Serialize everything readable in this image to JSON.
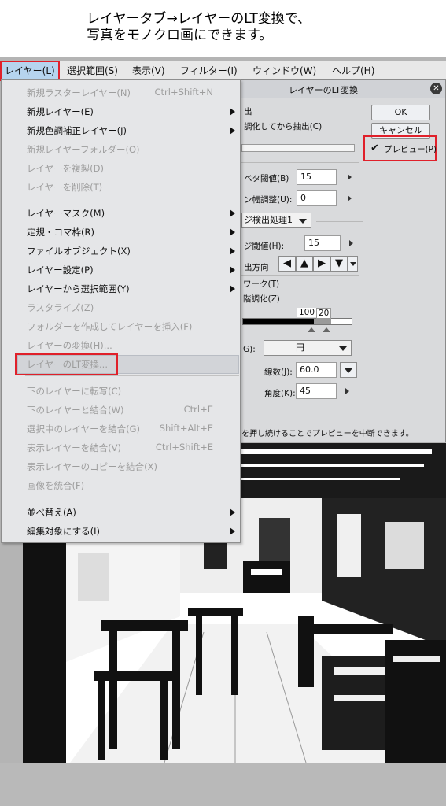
{
  "caption": {
    "line1": "レイヤータブ→レイヤーのLT変換で、",
    "line2": "写真をモノクロ画にできます。"
  },
  "menubar": {
    "items": [
      "レイヤー(L)",
      "選択範囲(S)",
      "表示(V)",
      "フィルター(I)",
      "ウィンドウ(W)",
      "ヘルプ(H)"
    ]
  },
  "layer_menu": {
    "items": [
      {
        "label": "新規ラスターレイヤー(N)",
        "shortcut": "Ctrl+Shift+N",
        "enabled": false
      },
      {
        "label": "新規レイヤー(E)",
        "shortcut": "",
        "enabled": true,
        "submenu": true
      },
      {
        "label": "新規色調補正レイヤー(J)",
        "shortcut": "",
        "enabled": true,
        "submenu": true
      },
      {
        "label": "新規レイヤーフォルダー(O)",
        "shortcut": "",
        "enabled": false
      },
      {
        "label": "レイヤーを複製(D)",
        "shortcut": "",
        "enabled": false
      },
      {
        "label": "レイヤーを削除(T)",
        "shortcut": "",
        "enabled": false
      },
      {
        "label": "レイヤーマスク(M)",
        "shortcut": "",
        "enabled": true,
        "submenu": true
      },
      {
        "label": "定規・コマ枠(R)",
        "shortcut": "",
        "enabled": true,
        "submenu": true
      },
      {
        "label": "ファイルオブジェクト(X)",
        "shortcut": "",
        "enabled": true,
        "submenu": true
      },
      {
        "label": "レイヤー設定(P)",
        "shortcut": "",
        "enabled": true,
        "submenu": true
      },
      {
        "label": "レイヤーから選択範囲(Y)",
        "shortcut": "",
        "enabled": true,
        "submenu": true
      },
      {
        "label": "ラスタライズ(Z)",
        "shortcut": "",
        "enabled": false
      },
      {
        "label": "フォルダーを作成してレイヤーを挿入(F)",
        "shortcut": "",
        "enabled": false
      },
      {
        "label": "レイヤーの変換(H)...",
        "shortcut": "",
        "enabled": false
      },
      {
        "label": "レイヤーのLT変換...",
        "shortcut": "",
        "enabled": false
      },
      {
        "label": "下のレイヤーに転写(C)",
        "shortcut": "",
        "enabled": false
      },
      {
        "label": "下のレイヤーと結合(W)",
        "shortcut": "Ctrl+E",
        "enabled": false
      },
      {
        "label": "選択中のレイヤーを結合(G)",
        "shortcut": "Shift+Alt+E",
        "enabled": false
      },
      {
        "label": "表示レイヤーを結合(V)",
        "shortcut": "Ctrl+Shift+E",
        "enabled": false
      },
      {
        "label": "表示レイヤーのコピーを結合(X)",
        "shortcut": "",
        "enabled": false
      },
      {
        "label": "画像を統合(F)",
        "shortcut": "",
        "enabled": false
      },
      {
        "label": "並べ替え(A)",
        "shortcut": "",
        "enabled": true,
        "submenu": true
      },
      {
        "label": "編集対象にする(I)",
        "shortcut": "",
        "enabled": true,
        "submenu": true
      }
    ]
  },
  "dialog": {
    "title": "レイヤーのLT変換",
    "ok_label": "OK",
    "cancel_label": "キャンセル",
    "preview_label": "プレビュー(P)",
    "preview_checked": true,
    "line_extract_partial": "出",
    "gray_then_extract": "調化してから抽出(C)",
    "black_threshold_label": "ベタ閾値(B)",
    "black_threshold_value": "15",
    "width_adjust_label": "ン幅調整(U):",
    "width_adjust_value": "0",
    "edge_process_value": "ジ検出処理1",
    "edge_threshold_label": "ジ閾値(H):",
    "edge_threshold_value": "15",
    "direction_label": "出方向",
    "tone_work_label": "ワーク(T)",
    "gradation_label": "階調化(Z)",
    "gradation_values": [
      "100",
      "20"
    ],
    "shape_label": "G):",
    "shape_value": "円",
    "lines_label": "線数(J):",
    "lines_value": "60.0",
    "angle_label": "角度(K):",
    "angle_value": "45",
    "footer_note": "を押し続けることでプレビューを中断できます。"
  },
  "icons": {
    "close": "close-icon",
    "direction_buttons": [
      "arrow-left-icon",
      "arrow-up-icon",
      "arrow-right-icon",
      "arrow-down-icon"
    ]
  },
  "colors": {
    "highlight_red": "#e0202a",
    "menu_active": "#b6d4ee"
  }
}
